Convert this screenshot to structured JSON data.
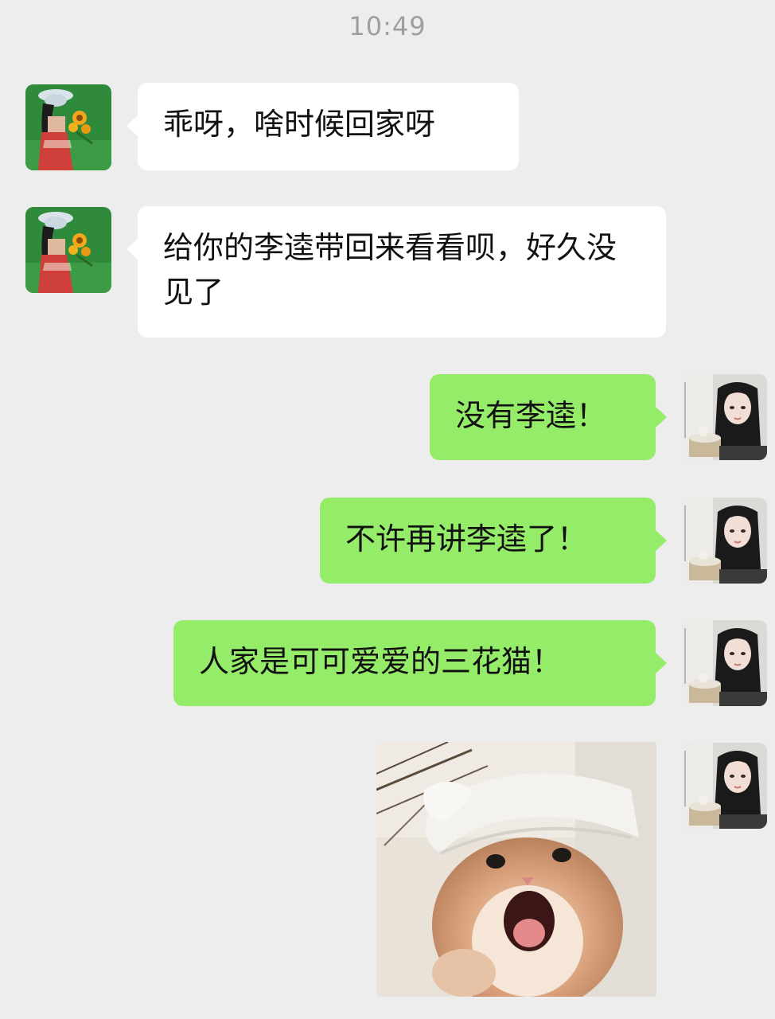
{
  "status": {
    "time": "10:49"
  },
  "chat": {
    "messages": [
      {
        "side": "incoming",
        "avatar": "green-girl-sunflower-avatar",
        "text": "乖呀，啥时候回家呀"
      },
      {
        "side": "incoming",
        "avatar": "green-girl-sunflower-avatar",
        "text": "给你的李逵带回来看看呗，好久没见了"
      },
      {
        "side": "outgoing",
        "avatar": "dark-hair-girl-avatar",
        "text": "没有李逵！"
      },
      {
        "side": "outgoing",
        "avatar": "dark-hair-girl-avatar",
        "text": "不许再讲李逵了！"
      },
      {
        "side": "outgoing",
        "avatar": "dark-hair-girl-avatar",
        "text": "人家是可可爱爱的三花猫！"
      },
      {
        "side": "outgoing",
        "avatar": "dark-hair-girl-avatar",
        "type": "image",
        "image": "kitten-in-white-hat-meme"
      }
    ]
  },
  "colors": {
    "background": "#ededed",
    "incoming_bubble": "#ffffff",
    "outgoing_bubble": "#95ec69",
    "time_text": "#9e9e9e"
  }
}
